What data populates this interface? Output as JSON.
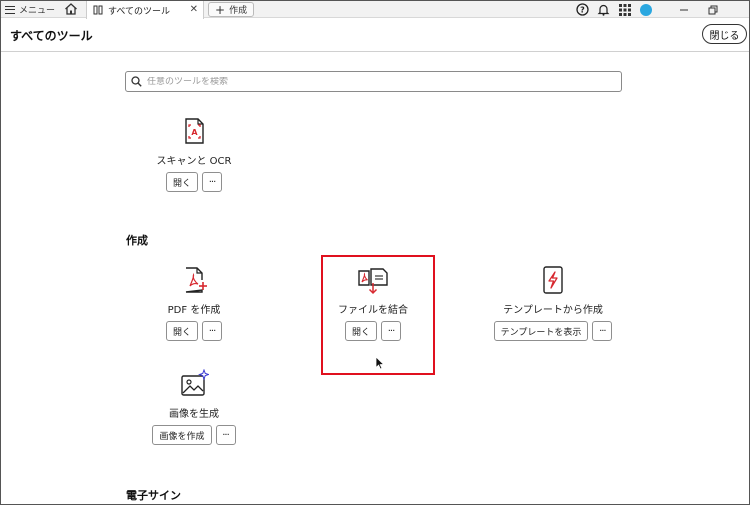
{
  "topbar": {
    "menu_label": "メニュー",
    "active_tab_label": "すべてのツール",
    "new_tab_label": "作成",
    "close_tab_glyph": "✕"
  },
  "header": {
    "title": "すべてのツール",
    "close_button_label": "閉じる"
  },
  "search": {
    "placeholder": "任意のツールを検索"
  },
  "sections": {
    "create_title": "作成",
    "esign_title": "電子サイン"
  },
  "tools": {
    "scan_ocr": {
      "label": "スキャンと OCR",
      "open_label": "開く",
      "more_label": "···"
    },
    "create_pdf": {
      "label": "PDF を作成",
      "open_label": "開く",
      "more_label": "···"
    },
    "combine_files": {
      "label": "ファイルを結合",
      "open_label": "開く",
      "more_label": "···"
    },
    "create_from_template": {
      "label": "テンプレートから作成",
      "open_label": "テンプレートを表示",
      "more_label": "···"
    },
    "generate_image": {
      "label": "画像を生成",
      "open_label": "画像を作成",
      "more_label": "···"
    }
  },
  "colors": {
    "highlight": "#e0101e",
    "acrobat_red": "#d7282f",
    "avatar": "#2aa7e0"
  },
  "icons": [
    "hamburger-icon",
    "home-icon",
    "tools-tab-icon",
    "plus-icon",
    "help-icon",
    "bell-icon",
    "apps-grid-icon",
    "avatar",
    "minimize-icon",
    "restore-icon",
    "search-icon",
    "scan-ocr-icon",
    "create-pdf-icon",
    "combine-files-icon",
    "template-icon",
    "generate-image-icon",
    "mouse-cursor-icon"
  ]
}
